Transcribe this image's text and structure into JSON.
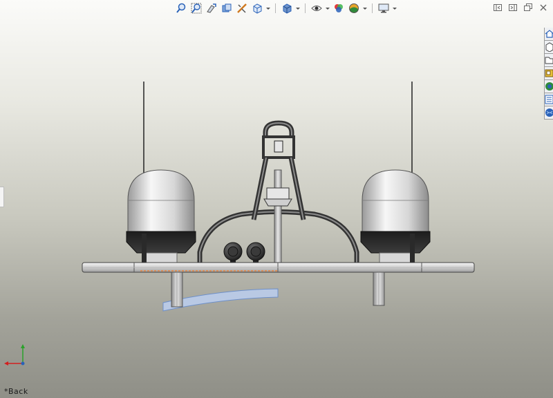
{
  "view": {
    "name": "*Back"
  },
  "toolbar": {
    "items": [
      {
        "name": "zoom-to-fit-icon"
      },
      {
        "name": "zoom-to-area-icon"
      },
      {
        "name": "previous-view-icon"
      },
      {
        "name": "section-view-icon"
      },
      {
        "name": "dynamic-annotation-icon"
      },
      {
        "name": "view-orientation-icon"
      },
      {
        "name": "display-style-icon"
      },
      {
        "name": "hide-show-items-icon"
      },
      {
        "name": "edit-appearance-icon"
      },
      {
        "name": "apply-scene-icon"
      },
      {
        "name": "view-settings-icon"
      }
    ]
  },
  "window_controls": [
    "tile-left-icon",
    "tile-right-icon",
    "restore-icon",
    "close-icon"
  ],
  "task_pane": {
    "tabs": [
      "home-icon",
      "design-library-icon",
      "file-explorer-icon",
      "view-palette-icon",
      "appearances-icon",
      "custom-properties-icon",
      "solidworks-forum-icon"
    ]
  },
  "colors": {
    "accent_blue": "#2a62b8",
    "triad_x": "#d21f1f",
    "triad_y": "#2aa12a",
    "selection_orange": "#e8833a",
    "highlight_blue": "#b9c9e4"
  }
}
